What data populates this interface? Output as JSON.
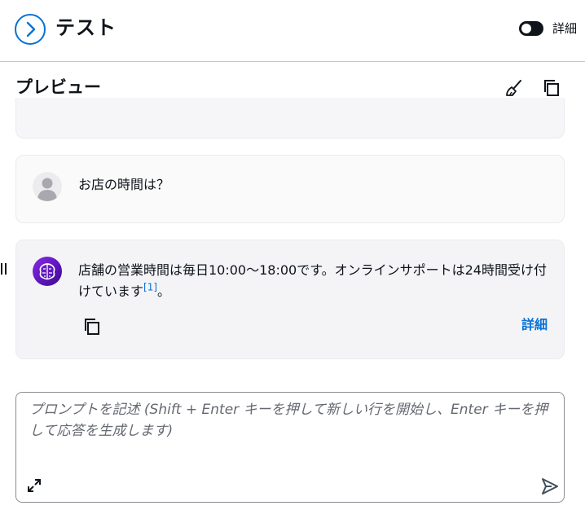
{
  "header": {
    "title": "テスト",
    "toggle_label": "詳細",
    "toggle_on": false,
    "accent_color": "#0972d3"
  },
  "preview": {
    "title": "プレビュー",
    "clear_icon": "broom-icon",
    "copy_icon": "copy-icon"
  },
  "messages": {
    "user": {
      "text": "お店の時間は？",
      "avatar_icon": "user-avatar-icon"
    },
    "assistant": {
      "text": " 店舗の営業時間は毎日10:00〜18:00です。オンラインサポートは24時間受け付けています",
      "citation": "[1]",
      "text_end": "。",
      "avatar_icon": "ai-brain-icon",
      "copy_icon": "copy-icon",
      "details_label": "詳細"
    }
  },
  "prompt": {
    "placeholder": "プロンプトを記述 (Shift + Enter キーを押して新しい行を開始し、Enter キーを押して応答を生成します)",
    "expand_icon": "expand-icon",
    "send_icon": "send-icon"
  }
}
